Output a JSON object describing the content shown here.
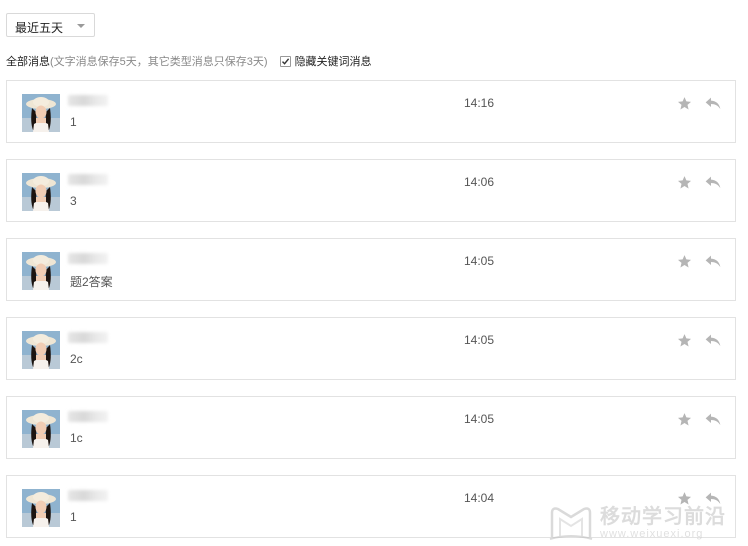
{
  "filter": {
    "range_select": "最近五天",
    "all_label": "全部消息",
    "retention_note": "(文字消息保存5天，其它类型消息只保存3天)",
    "hide_keyword_label": "隐藏关键词消息",
    "hide_keyword_checked": true
  },
  "messages": [
    {
      "text": "1",
      "time": "14:16"
    },
    {
      "text": "3",
      "time": "14:06"
    },
    {
      "text": "题2答案",
      "time": "14:05"
    },
    {
      "text": "2c",
      "time": "14:05"
    },
    {
      "text": "1c",
      "time": "14:05"
    },
    {
      "text": "1",
      "time": "14:04"
    }
  ],
  "icons": {
    "star": "star-icon",
    "reply": "reply-icon",
    "checkbox": "checkmark-icon"
  },
  "colors": {
    "icon_gray": "#b5b5b5",
    "border": "#e2e2e2"
  },
  "watermark": {
    "title": "移动学习前沿",
    "url": "www.weixuexi.org"
  }
}
